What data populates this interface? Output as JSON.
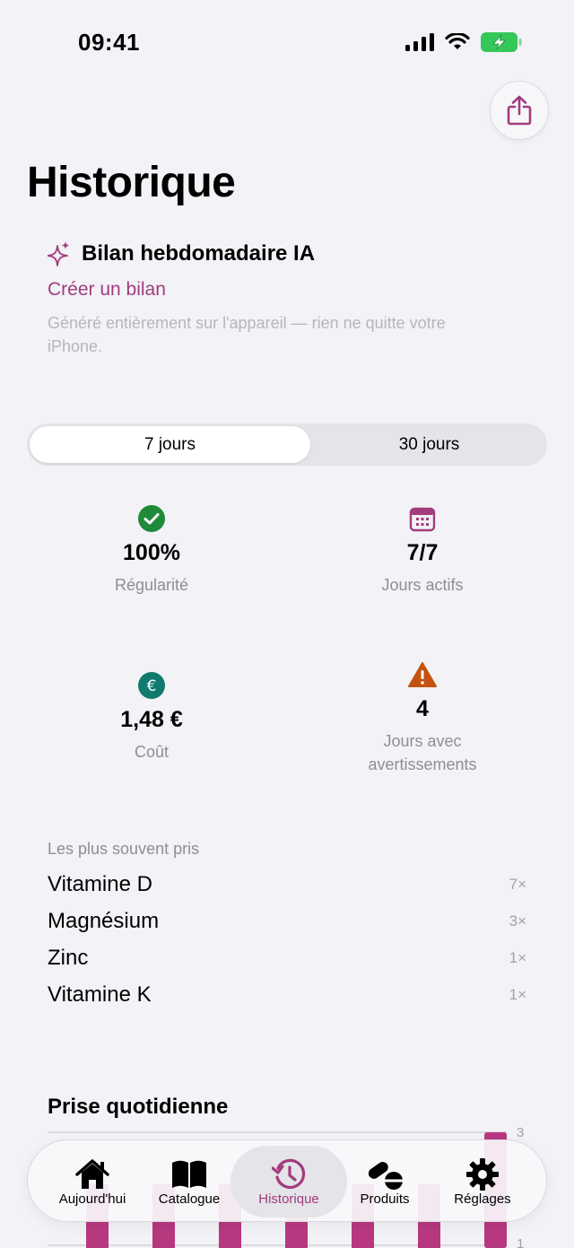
{
  "status": {
    "time": "09:41"
  },
  "page": {
    "title": "Historique"
  },
  "ai_summary": {
    "title": "Bilan hebdomadaire IA",
    "action": "Créer un bilan",
    "note": "Généré entièrement sur l'appareil — rien ne quitte votre iPhone."
  },
  "range": {
    "options": [
      "7 jours",
      "30 jours"
    ],
    "selected": "7 jours"
  },
  "stats": [
    {
      "value": "100%",
      "label": "Régularité",
      "icon": "check-circle-icon"
    },
    {
      "value": "7/7",
      "label": "Jours actifs",
      "icon": "calendar-icon"
    },
    {
      "value": "1,48 €",
      "label": "Coût",
      "icon": "euro-circle-icon"
    },
    {
      "value": "4",
      "label": "Jours avec avertissements",
      "icon": "warning-icon"
    }
  ],
  "frequent": {
    "heading": "Les plus souvent pris",
    "items": [
      {
        "name": "Vitamine D",
        "count": "7×"
      },
      {
        "name": "Magnésium",
        "count": "3×"
      },
      {
        "name": "Zinc",
        "count": "1×"
      },
      {
        "name": "Vitamine K",
        "count": "1×"
      }
    ]
  },
  "daily_chart": {
    "title": "Prise quotidienne",
    "y_ticks": [
      "3",
      "1"
    ],
    "bar_color": "#b8387f"
  },
  "tabs": [
    {
      "label": "Aujourd'hui",
      "icon": "house-icon"
    },
    {
      "label": "Catalogue",
      "icon": "book-icon"
    },
    {
      "label": "Historique",
      "icon": "history-icon",
      "active": true
    },
    {
      "label": "Produits",
      "icon": "pills-icon"
    },
    {
      "label": "Réglages",
      "icon": "gear-icon"
    }
  ],
  "colors": {
    "accent": "#a23c7d",
    "success": "#1f8a3a",
    "euro": "#117a6f",
    "warning": "#c4530f",
    "calendar": "#a23c7d"
  }
}
